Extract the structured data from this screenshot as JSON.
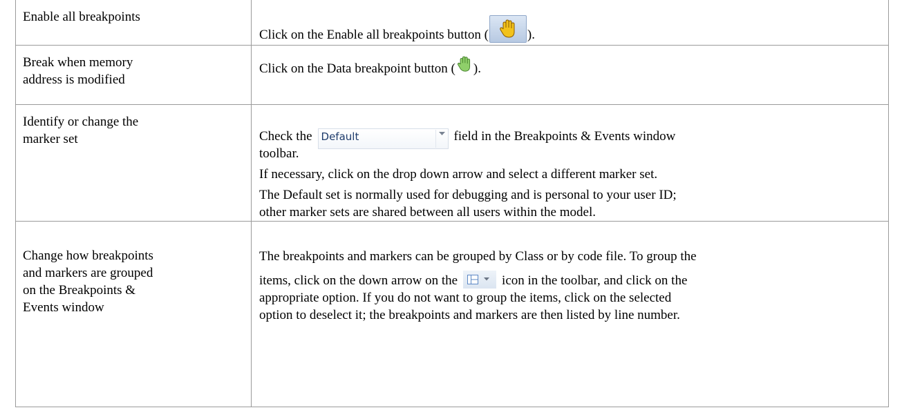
{
  "rows": [
    {
      "action": "Enable all breakpoints",
      "instruction": {
        "before": "Click on the Enable all breakpoints button (",
        "after": ")."
      }
    },
    {
      "action": "Break when memory address is modified",
      "action_lines": [
        "Break when memory",
        "address is modified"
      ],
      "instruction": {
        "before": "Click on the Data breakpoint button (",
        "after": ")."
      }
    },
    {
      "action": "Identify or change the marker set",
      "action_lines": [
        "Identify or change the",
        "marker set"
      ],
      "instruction": {
        "before": "Check the",
        "combo_value": "Default",
        "after_line1": "field in the Breakpoints & Events window",
        "after_line2": "toolbar.",
        "para2": "If necessary, click on the drop down arrow and select a different marker set.",
        "para3_line1": "The Default set is normally used for debugging and is personal to your user ID;",
        "para3_line2": "other marker sets are shared between all users within the model."
      }
    },
    {
      "action": "Change how breakpoints and markers are grouped on the Breakpoints & Events window",
      "action_lines": [
        "Change how breakpoints",
        "and markers are grouped",
        "on the Breakpoints &",
        "Events window"
      ],
      "instruction": {
        "line1": "The breakpoints and markers can be grouped by Class or by code file. To group the",
        "line2_before": "items, click on the down arrow on the",
        "line2_after": "icon in the toolbar, and click on the",
        "line3": "appropriate option. If you do not want to group the items, click on the selected",
        "line4": "option to deselect it; the breakpoints and markers are then listed by line number."
      }
    }
  ],
  "icons": {
    "enable_all": "hand-icon-raised-button",
    "data_breakpoint": "green-hand-icon",
    "group_by": "group-layout-icon"
  }
}
